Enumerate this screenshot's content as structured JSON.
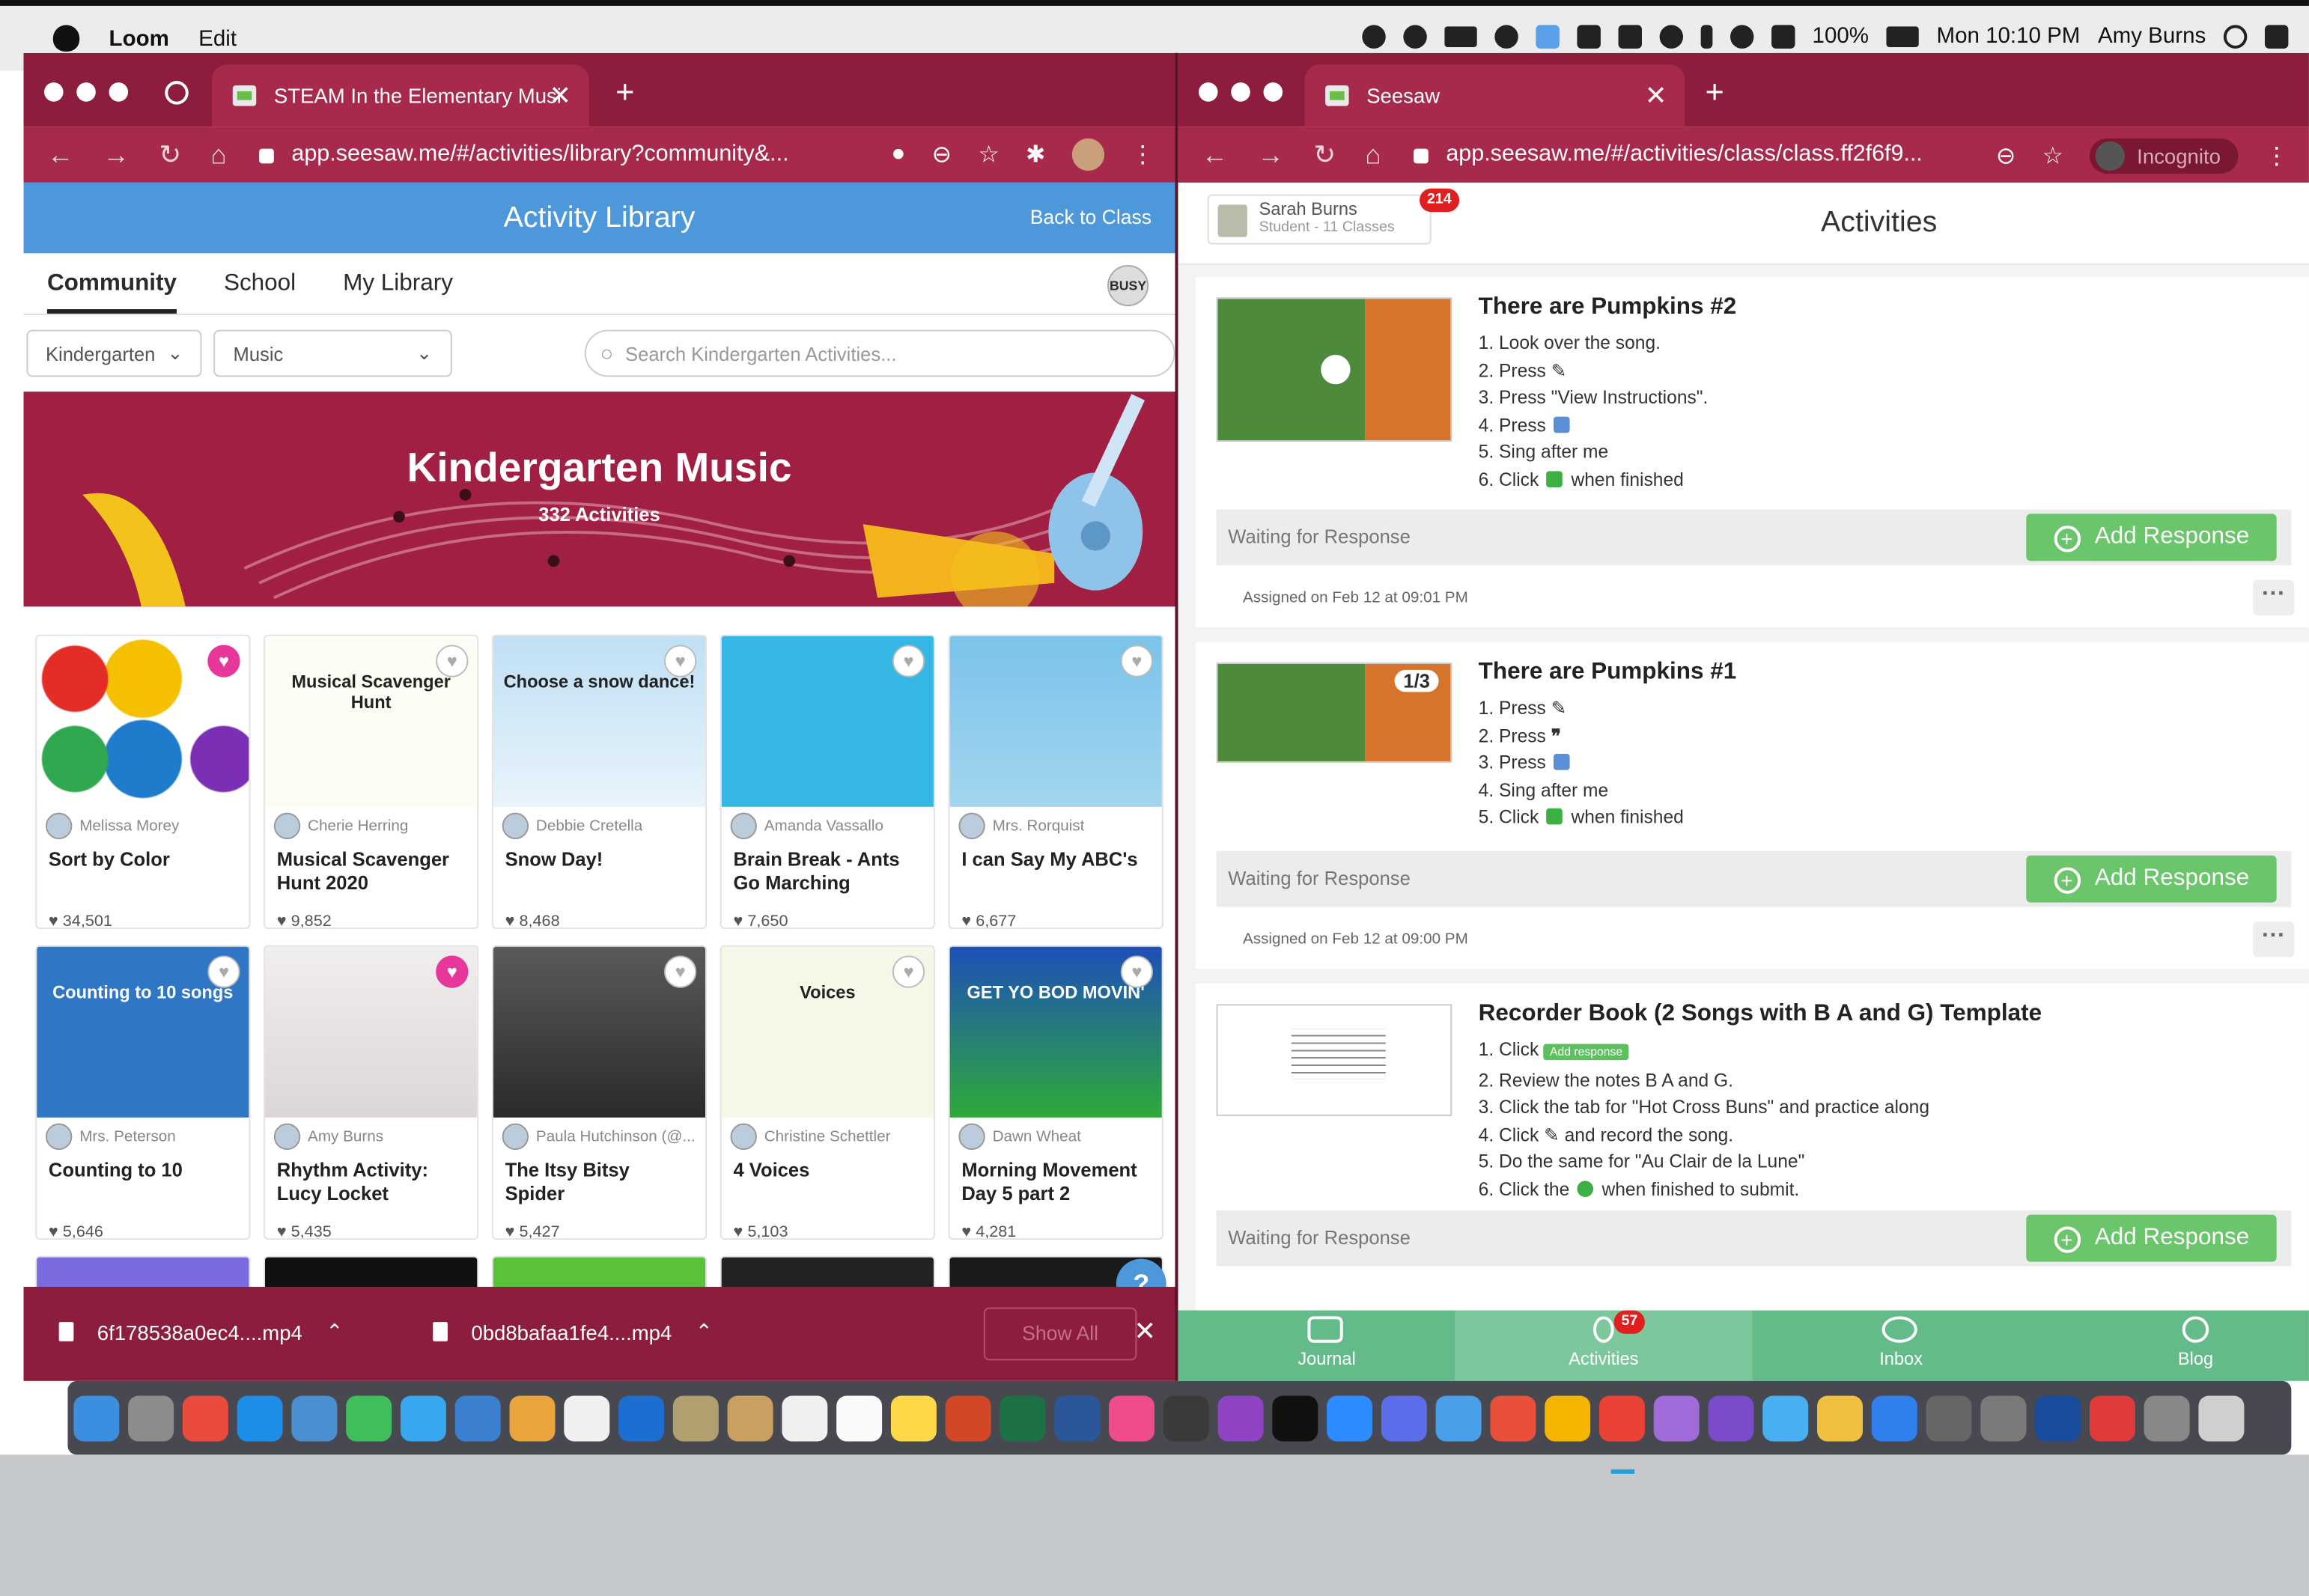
{
  "menubar": {
    "app": "Loom",
    "menu1": "Edit",
    "battery": "100%",
    "datetime": "Mon 10:10 PM",
    "user": "Amy Burns"
  },
  "left_browser": {
    "tab_title": "STEAM In the Elementary Musi",
    "url": "app.seesaw.me/#/activities/library?community&...",
    "header": "Activity Library",
    "back": "Back to Class",
    "tabs": [
      "Community",
      "School",
      "My Library"
    ],
    "grade": "Kindergarten",
    "subject": "Music",
    "search_placeholder": "Search Kindergarten Activities...",
    "banner_title": "Kindergarten Music",
    "banner_count": "332 Activities",
    "cards": [
      {
        "author": "Melissa Morey",
        "title": "Sort by Color",
        "likes": "34,501",
        "liked": true
      },
      {
        "author": "Cherie Herring",
        "title": "Musical Scavenger Hunt 2020",
        "likes": "9,852",
        "liked": false,
        "thumb_text": "Musical Scavenger Hunt"
      },
      {
        "author": "Debbie Cretella",
        "title": "Snow Day!",
        "likes": "8,468",
        "liked": false,
        "thumb_text": "Choose a snow dance!"
      },
      {
        "author": "Amanda Vassallo",
        "title": "Brain Break - Ants Go Marching",
        "likes": "7,650",
        "liked": false
      },
      {
        "author": "Mrs. Rorquist",
        "title": "I can Say My ABC's",
        "likes": "6,677",
        "liked": false
      },
      {
        "author": "Mrs. Peterson",
        "title": "Counting to 10",
        "likes": "5,646",
        "liked": false,
        "thumb_text": "Counting to 10 songs"
      },
      {
        "author": "Amy Burns",
        "title": "Rhythm Activity: Lucy Locket",
        "likes": "5,435",
        "liked": true
      },
      {
        "author": "Paula Hutchinson (@...",
        "title": "The Itsy Bitsy Spider",
        "likes": "5,427",
        "liked": false
      },
      {
        "author": "Christine Schettler",
        "title": "4 Voices",
        "likes": "5,103",
        "liked": false,
        "thumb_text": "Voices"
      },
      {
        "author": "Dawn Wheat",
        "title": "Morning Movement Day 5 part 2",
        "likes": "4,281",
        "liked": false,
        "thumb_text": "GET YO BOD MOVIN'"
      }
    ],
    "downloads": [
      "6f178538a0ec4....mp4",
      "0bd8bafaa1fe4....mp4"
    ],
    "show_all": "Show All"
  },
  "right_browser": {
    "tab_title": "Seesaw",
    "url": "app.seesaw.me/#/activities/class/class.ff2f6f9...",
    "incognito": "Incognito",
    "student_name": "Sarah Burns",
    "student_sub": "Student - 11 Classes",
    "badge": "214",
    "title": "Activities",
    "items": [
      {
        "title": "There are Pumpkins #2",
        "steps": [
          "1. Look over the song.",
          "2. Press",
          "3. Press \"View Instructions\".",
          "4. Press",
          "5. Sing after me",
          "6. Click",
          "when finished"
        ],
        "status": "Waiting for Response",
        "button": "Add Response",
        "assigned": "Assigned on Feb 12 at 09:01 PM"
      },
      {
        "title": "There are Pumpkins #1",
        "counter": "1/3",
        "steps": [
          "1. Press",
          "2. Press",
          "3. Press",
          "4. Sing after me",
          "5. Click",
          "when finished"
        ],
        "status": "Waiting for Response",
        "button": "Add Response",
        "assigned": "Assigned on Feb 12 at 09:00 PM"
      },
      {
        "title": "Recorder Book (2 Songs with B A and G) Template",
        "steps": [
          "1. Click",
          "2. Review the notes B A and G.",
          "3. Click the tab for \"Hot Cross Buns\" and practice along",
          "4. Click",
          "and record the song.",
          "5. Do the same for \"Au Clair de la Lune\"",
          "6. Click the",
          "when finished to submit."
        ],
        "inline_button": "Add response",
        "status": "Waiting for Response",
        "button": "Add Response"
      }
    ],
    "nav": [
      {
        "label": "Journal"
      },
      {
        "label": "Activities",
        "badge": "57"
      },
      {
        "label": "Inbox"
      },
      {
        "label": "Blog"
      }
    ]
  },
  "colors": {
    "seesaw_maroon": "#8c1d3c",
    "library_blue": "#4d98da",
    "add_green": "#6bc56b",
    "nav_green": "#64bb8a",
    "heart_pink": "#e8379b"
  }
}
